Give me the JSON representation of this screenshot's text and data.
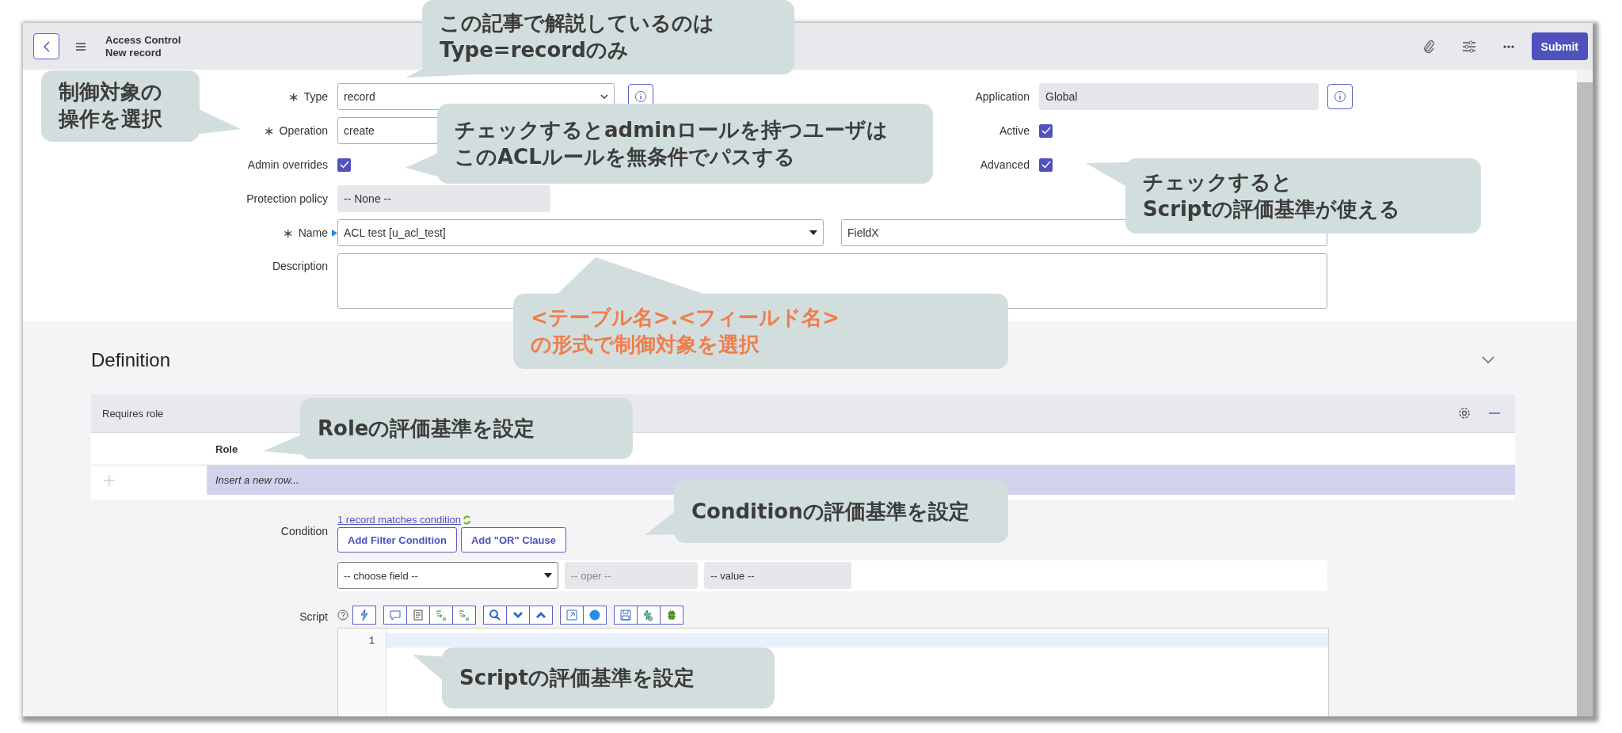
{
  "header": {
    "title": "Access Control",
    "subtitle": "New record",
    "submit": "Submit"
  },
  "form": {
    "rows": [
      {
        "left": {
          "kind": "select",
          "label": "Type",
          "required_mark": "∗",
          "value": "record",
          "dropdown_arrow": true,
          "info": true
        },
        "right": {
          "kind": "readonly",
          "label": "Application",
          "value": "Global",
          "info": true
        }
      },
      {
        "left": {
          "kind": "select",
          "label": "Operation",
          "required_mark": "∗",
          "value": "create"
        },
        "right": {
          "kind": "checkbox",
          "label": "Active",
          "checked": true
        }
      },
      {
        "left": {
          "kind": "checkbox",
          "label": "Admin overrides",
          "checked": true
        },
        "right": {
          "kind": "checkbox",
          "label": "Advanced",
          "checked": true
        }
      },
      {
        "left": {
          "kind": "readonly",
          "label": "Protection policy",
          "value": "-- None --"
        }
      }
    ],
    "name": {
      "label": "Name",
      "required_mark": "∗",
      "value": "ACL test [u_acl_test]",
      "field": "FieldX"
    },
    "description": {
      "label": "Description"
    }
  },
  "definition": {
    "title": "Definition",
    "expanded": true,
    "related_list": {
      "title": "Requires role",
      "columns": [
        "Role"
      ],
      "insert_row": "Insert a new row..."
    },
    "condition": {
      "label": "Condition",
      "link": "1 record matches condition",
      "buttons": [
        "Add Filter Condition",
        "Add \"OR\" Clause"
      ],
      "field": "-- choose field --",
      "oper": "-- oper --",
      "value": "-- value --"
    },
    "script": {
      "label": "Script",
      "line_numbers": [
        "1"
      ]
    }
  },
  "annotations": [
    {
      "lines": [
        "この記事で解説しているのは",
        "Type=recordのみ"
      ],
      "color": "#3c3c3c"
    },
    {
      "lines": [
        "制御対象の",
        "操作を選択"
      ],
      "color": "#3c3c3c"
    },
    {
      "lines": [
        "チェックするとadminロールを持つユーザは",
        "このACLルールを無条件でパスする"
      ],
      "color": "#3c3c3c"
    },
    {
      "lines": [
        "チェックすると",
        "Scriptの評価基準が使える"
      ],
      "color": "#3c3c3c"
    },
    {
      "lines": [
        "<テーブル名>.<フィールド名>",
        "の形式で制御対象を選択"
      ],
      "color": "#f07c4a"
    },
    {
      "lines": [
        "Roleの評価基準を設定"
      ],
      "color": "#3c3c3c"
    },
    {
      "lines": [
        "Conditionの評価基準を設定"
      ],
      "color": "#3c3c3c"
    },
    {
      "lines": [
        "Scriptの評価基準を設定"
      ],
      "color": "#3c3c3c"
    }
  ]
}
